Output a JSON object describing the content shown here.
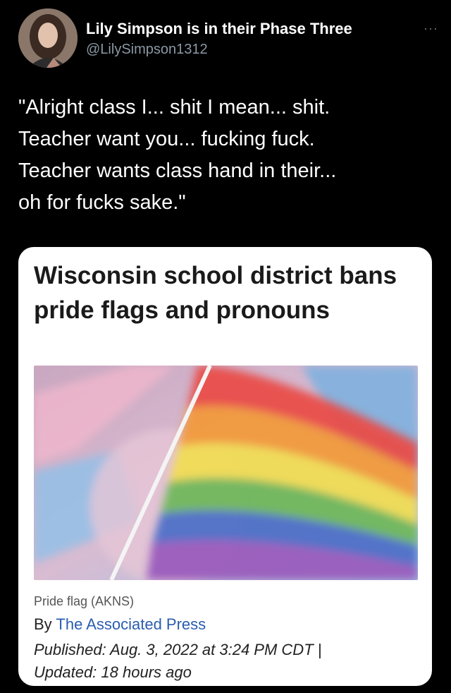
{
  "tweet": {
    "display_name": "Lily Simpson is in their Phase Three",
    "handle": "@LilySimpson1312",
    "more_icon": "···",
    "text": "\"Alright class I... shit I mean... shit.\nTeacher want you... fucking fuck.\nTeacher wants class hand in their...\noh for fucks sake.\""
  },
  "article": {
    "headline": "Wisconsin school district bans pride flags and pronouns",
    "caption": "Pride flag  (AKNS)",
    "by_prefix": "By ",
    "by_org": "The Associated Press",
    "published": "Published: Aug. 3, 2022 at 3:24 PM CDT |",
    "updated": "Updated: 18 hours ago"
  },
  "colors": {
    "background": "#000000",
    "card": "#ffffff",
    "link": "#2a5db0",
    "handle": "#8b98a5"
  }
}
